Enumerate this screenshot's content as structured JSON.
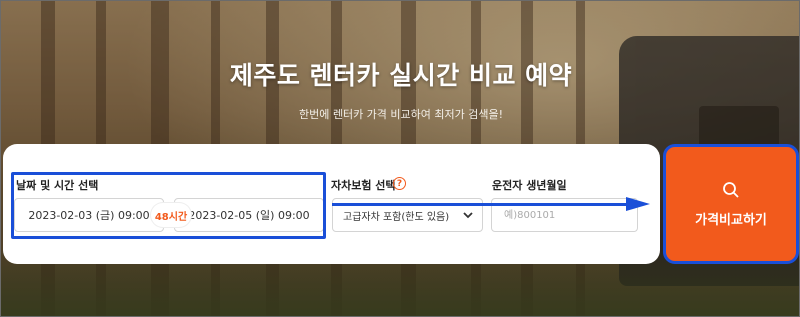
{
  "hero": {
    "title": "제주도 렌터카 실시간 비교 예약",
    "subtitle": "한번에 렌터카 가격 비교하여 최저가 검색을!"
  },
  "booking": {
    "date_label": "날짜 및 시간 선택",
    "start_datetime": "2023-02-03 (금) 09:00",
    "end_datetime": "2023-02-05 (일) 09:00",
    "duration_badge": "48시간",
    "insurance_label": "자차보험 선택",
    "insurance_selected": "고급자차 포함(한도 있음)",
    "birth_label": "운전자 생년월일",
    "birth_placeholder": "예)800101"
  },
  "actions": {
    "compare_label": "가격비교하기"
  },
  "colors": {
    "accent": "#f25a1c",
    "annotation": "#1a4fd8"
  }
}
